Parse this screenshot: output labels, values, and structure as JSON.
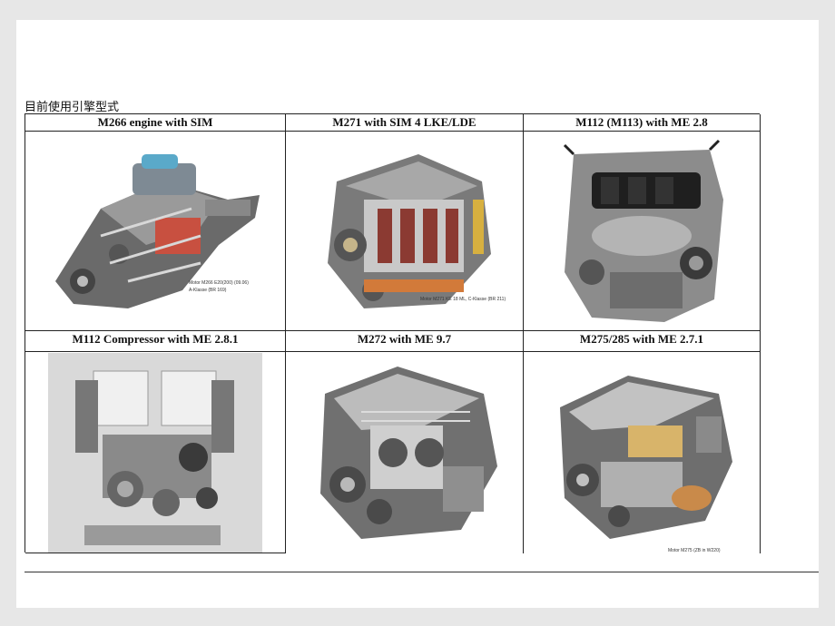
{
  "heading": "目前使用引擎型式",
  "engines": [
    {
      "label": "M266 engine with SIM",
      "caption_line1": "Motor M266 E20(200) (09.06)",
      "caption_line2": "A-Klasse (BR 169)",
      "style": "cutaway"
    },
    {
      "label": "M271 with SIM 4 LKE/LDE",
      "caption_line1": "Motor  M271 KE 18 ML, C-Klasse (BR 211)",
      "style": "cutaway"
    },
    {
      "label": "M112 (M113)  with  ME 2.8",
      "style": "photo"
    },
    {
      "label": "M112 Compressor with ME 2.8.1",
      "style": "render"
    },
    {
      "label": "M272 with  ME 9.7",
      "style": "cutaway"
    },
    {
      "label": "M275/285 with ME 2.7.1",
      "caption_line1": "Motor M275     (ZB in W220)",
      "style": "cutaway"
    }
  ]
}
